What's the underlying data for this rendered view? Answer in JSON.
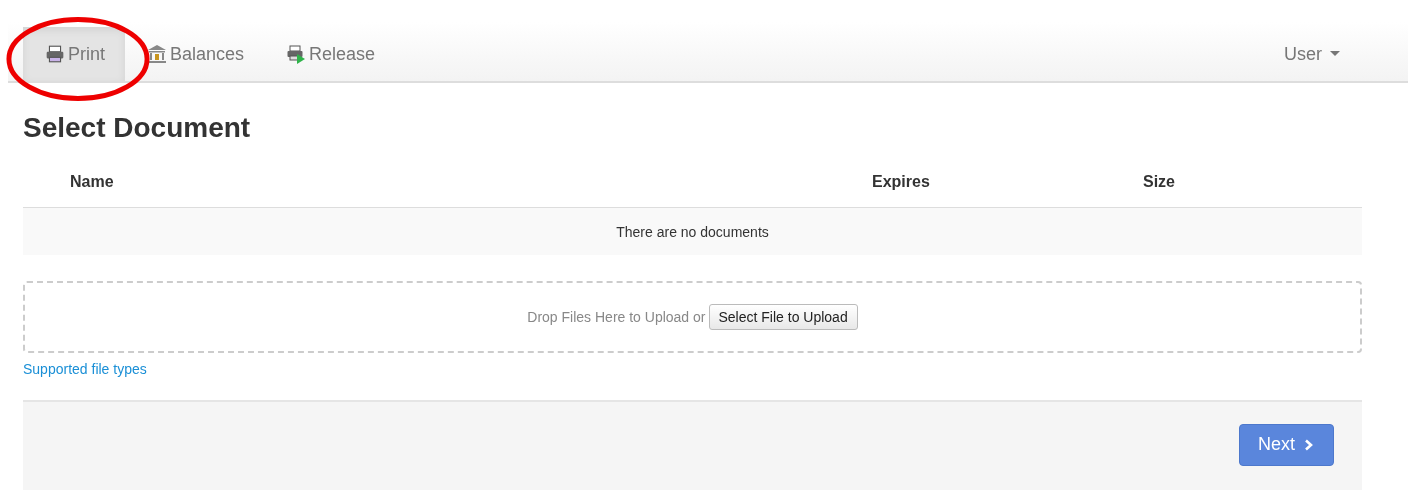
{
  "nav": {
    "items": [
      {
        "label": "Print",
        "kind": "printer",
        "selected": true
      },
      {
        "label": "Balances",
        "kind": "bank",
        "selected": false
      },
      {
        "label": "Release",
        "kind": "release",
        "selected": false
      }
    ],
    "user_menu": {
      "label": "User"
    }
  },
  "heading": "Select Document",
  "table": {
    "columns": [
      "Name",
      "Expires",
      "Size"
    ],
    "empty_message": "There are no documents"
  },
  "upload": {
    "prompt": "Drop Files Here to Upload or",
    "button": "Select File to Upload"
  },
  "supported_link": "Supported file types",
  "footer": {
    "next_button": "Next"
  }
}
